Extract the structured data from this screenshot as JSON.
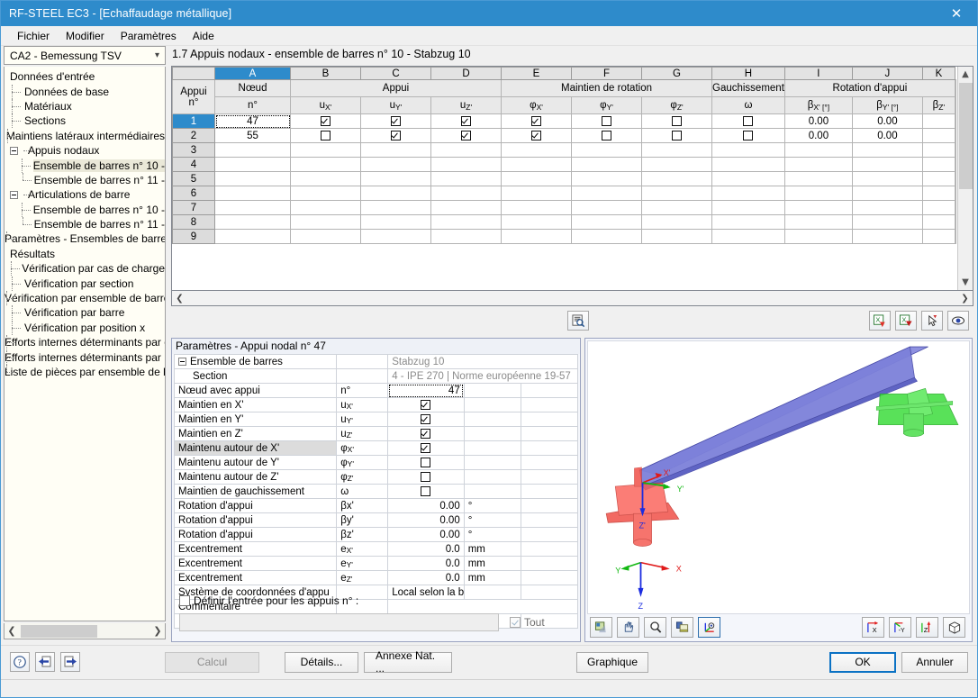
{
  "window": {
    "title": "RF-STEEL EC3 - [Echaffaudage métallique]",
    "close_icon": "close-icon"
  },
  "menu": {
    "items": [
      "Fichier",
      "Modifier",
      "Paramètres",
      "Aide"
    ]
  },
  "sidebar": {
    "combo_value": "CA2 - Bemessung TSV",
    "tree": [
      {
        "label": "Données d'entrée",
        "level": 0,
        "kind": "root"
      },
      {
        "label": "Données de base",
        "level": 1,
        "kind": "leaf"
      },
      {
        "label": "Matériaux",
        "level": 1,
        "kind": "leaf"
      },
      {
        "label": "Sections",
        "level": 1,
        "kind": "leaf"
      },
      {
        "label": "Maintiens latéraux intermédiaires",
        "level": 1,
        "kind": "leaf"
      },
      {
        "label": "Appuis nodaux",
        "level": 1,
        "kind": "group"
      },
      {
        "label": "Ensemble de barres n° 10 -",
        "level": 2,
        "kind": "leaf",
        "selected": true
      },
      {
        "label": "Ensemble de barres n° 11 -",
        "level": 2,
        "kind": "leaf-last"
      },
      {
        "label": "Articulations de barre",
        "level": 1,
        "kind": "group"
      },
      {
        "label": "Ensemble de barres n° 10 -",
        "level": 2,
        "kind": "leaf"
      },
      {
        "label": "Ensemble de barres n° 11 -",
        "level": 2,
        "kind": "leaf-last"
      },
      {
        "label": "Paramètres - Ensembles de barres",
        "level": 1,
        "kind": "leaf-last"
      },
      {
        "label": "Résultats",
        "level": 0,
        "kind": "root"
      },
      {
        "label": "Vérification par cas de charge",
        "level": 1,
        "kind": "leaf"
      },
      {
        "label": "Vérification par section",
        "level": 1,
        "kind": "leaf"
      },
      {
        "label": "Vérification par ensemble de barres",
        "level": 1,
        "kind": "leaf"
      },
      {
        "label": "Vérification par barre",
        "level": 1,
        "kind": "leaf"
      },
      {
        "label": "Vérification par position x",
        "level": 1,
        "kind": "leaf"
      },
      {
        "label": "Efforts internes déterminants par ens.",
        "level": 1,
        "kind": "leaf"
      },
      {
        "label": "Efforts internes déterminants par barre",
        "level": 1,
        "kind": "leaf"
      },
      {
        "label": "Liste de pièces  par ensemble de barres",
        "level": 1,
        "kind": "leaf-last"
      }
    ]
  },
  "content": {
    "tab_title": "1.7 Appuis nodaux - ensemble de barres n° 10 - Stabzug 10"
  },
  "grid": {
    "column_letters": [
      "A",
      "B",
      "C",
      "D",
      "E",
      "F",
      "G",
      "H",
      "I",
      "J",
      "K"
    ],
    "active_column": "A",
    "corner_header_line1": "Appui",
    "corner_header_line2": "n°",
    "group_headers": [
      {
        "label": "Nœud",
        "span": 1
      },
      {
        "label": "Appui",
        "span": 3
      },
      {
        "label": "Maintien de rotation",
        "span": 3
      },
      {
        "label": "Gauchissement",
        "span": 1
      },
      {
        "label": "Rotation d'appui",
        "span": 3
      }
    ],
    "sub_headers": [
      "n°",
      "u X'",
      "u Y'",
      "u Z'",
      "φ X'",
      "φ Y'",
      "φ Z'",
      "ω",
      "β X' [°]",
      "β Y' [°]",
      "β Z'"
    ],
    "rows": [
      {
        "n": "1",
        "selected": true,
        "node": "47",
        "ux": true,
        "uy": true,
        "uz": true,
        "px": true,
        "py": false,
        "pz": false,
        "omega": false,
        "bx": "0.00",
        "by": "0.00",
        "bz": ""
      },
      {
        "n": "2",
        "selected": false,
        "node": "55",
        "ux": false,
        "uy": true,
        "uz": true,
        "px": true,
        "py": false,
        "pz": false,
        "omega": false,
        "bx": "0.00",
        "by": "0.00",
        "bz": ""
      },
      {
        "n": "3",
        "node": "",
        "empty": true
      },
      {
        "n": "4",
        "node": "",
        "empty": true
      },
      {
        "n": "5",
        "node": "",
        "empty": true
      },
      {
        "n": "6",
        "node": "",
        "empty": true
      },
      {
        "n": "7",
        "node": "",
        "empty": true
      },
      {
        "n": "8",
        "node": "",
        "empty": true
      },
      {
        "n": "9",
        "node": "",
        "empty": true
      }
    ],
    "toolbar": {
      "left": [
        {
          "icon": "document-search-icon"
        }
      ],
      "right": [
        {
          "icon": "excel-import-icon"
        },
        {
          "icon": "excel-export-icon"
        },
        {
          "icon": "pick-cursor-icon"
        },
        {
          "icon": "eye-icon"
        }
      ]
    }
  },
  "params": {
    "header": "Paramètres - Appui nodal n° 47",
    "rows": [
      {
        "name": "Ensemble de barres",
        "sym": "",
        "val": "Stabzug 10",
        "unit": "",
        "type": "wide",
        "tree": "expander"
      },
      {
        "name": "Section",
        "sym": "",
        "val": "4 - IPE 270 | Norme européenne 19-57",
        "unit": "",
        "type": "wide",
        "tree": "elbow"
      },
      {
        "name": "Nœud avec appui",
        "sym": "n°",
        "val": "47",
        "unit": "",
        "type": "value",
        "focus": true
      },
      {
        "name": "Maintien en X'",
        "sym": "u X'",
        "val": true,
        "unit": "",
        "type": "check"
      },
      {
        "name": "Maintien en Y'",
        "sym": "u Y'",
        "val": true,
        "unit": "",
        "type": "check"
      },
      {
        "name": "Maintien en Z'",
        "sym": "u Z'",
        "val": true,
        "unit": "",
        "type": "check"
      },
      {
        "name": "Maintenu autour de X'",
        "sym": "φ X'",
        "val": true,
        "unit": "",
        "type": "check",
        "highlight": true
      },
      {
        "name": "Maintenu autour de Y'",
        "sym": "φ Y'",
        "val": false,
        "unit": "",
        "type": "check"
      },
      {
        "name": "Maintenu autour de Z'",
        "sym": "φ Z'",
        "val": false,
        "unit": "",
        "type": "check"
      },
      {
        "name": "Maintien de gauchissement",
        "sym": "ω",
        "val": false,
        "unit": "",
        "type": "check"
      },
      {
        "name": "Rotation d'appui",
        "sym": "βx'",
        "val": "0.00",
        "unit": "°",
        "type": "value"
      },
      {
        "name": "Rotation d'appui",
        "sym": "βy'",
        "val": "0.00",
        "unit": "°",
        "type": "value"
      },
      {
        "name": "Rotation d'appui",
        "sym": "βz'",
        "val": "0.00",
        "unit": "°",
        "type": "value"
      },
      {
        "name": "Excentrement",
        "sym": "e X'",
        "val": "0.0",
        "unit": "mm",
        "type": "value"
      },
      {
        "name": "Excentrement",
        "sym": "e Y'",
        "val": "0.0",
        "unit": "mm",
        "type": "value"
      },
      {
        "name": "Excentrement",
        "sym": "e Z'",
        "val": "0.0",
        "unit": "mm",
        "type": "value"
      },
      {
        "name": "Système de coordonnées d'appu",
        "sym": "",
        "val": "Local selon la b",
        "unit": "",
        "type": "text"
      },
      {
        "name": "Commentaire",
        "sym": "",
        "val": "",
        "unit": "",
        "type": "blank"
      },
      {
        "name": "",
        "sym": "",
        "val": "",
        "unit": "",
        "type": "gray"
      }
    ],
    "footer": {
      "define_label": "Définir l'entrée pour les appuis n° :",
      "define_checked": false,
      "field_value": "",
      "all_label": "Tout",
      "all_checked": true
    }
  },
  "viewer": {
    "toolbar_left": [
      {
        "icon": "render-mode-icon"
      },
      {
        "icon": "rotate-hand-icon"
      },
      {
        "icon": "zoom-magnifier-icon"
      },
      {
        "icon": "layers-icon"
      },
      {
        "icon": "axis-view-icon",
        "active": true
      }
    ],
    "toolbar_right": [
      {
        "icon": "view-x-icon",
        "label": "X"
      },
      {
        "icon": "view-y-icon",
        "label": "-Y"
      },
      {
        "icon": "view-z-icon",
        "label": "Z"
      },
      {
        "icon": "isometric-cube-icon"
      }
    ],
    "axis_labels_local": [
      "X'",
      "Y'",
      "Z'"
    ],
    "axis_labels_global": [
      "X",
      "Y",
      "Z"
    ],
    "colors": {
      "beam": "#6b6fd0",
      "support_start": "#ee3b35",
      "support_end": "#2fd43a",
      "axis_x": "#e01b1b",
      "axis_y": "#12b812",
      "axis_z": "#1b2ce0"
    }
  },
  "bottom": {
    "icon_buttons": [
      {
        "icon": "help-question-icon"
      },
      {
        "icon": "import-arrow-icon"
      },
      {
        "icon": "export-arrow-icon"
      }
    ],
    "calcul": "Calcul",
    "details": "Détails...",
    "annexe": "Annexe Nat. ...",
    "graphique": "Graphique",
    "ok": "OK",
    "annuler": "Annuler"
  },
  "colors": {
    "accent": "#2e8bcb",
    "titlebar": "#2e8bcb",
    "selection": "#2e8bcb"
  }
}
